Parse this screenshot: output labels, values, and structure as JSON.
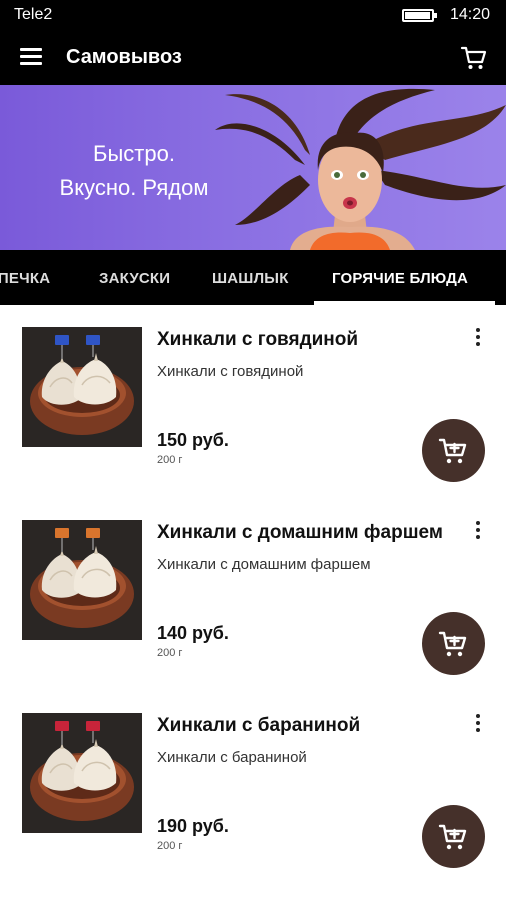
{
  "status_bar": {
    "carrier": "Tele2",
    "time": "14:20",
    "battery_level": 0.9
  },
  "app_bar": {
    "title": "Самовывоз"
  },
  "banner": {
    "line1": "Быстро.",
    "line2": "Вкусно. Рядом"
  },
  "tabs": [
    {
      "label": "ВЫПЕЧКА",
      "active": false
    },
    {
      "label": "ЗАКУСКИ",
      "active": false
    },
    {
      "label": "ШАШЛЫК",
      "active": false
    },
    {
      "label": "ГОРЯЧИЕ БЛЮДА",
      "active": true
    }
  ],
  "products": [
    {
      "name": "Хинкали с говядиной",
      "description": "Хинкали с говядиной",
      "price": "150 руб.",
      "weight": "200 г"
    },
    {
      "name": "Хинкали с домашним фаршем",
      "description": "Хинкали с домашним фаршем",
      "price": "140 руб.",
      "weight": "200 г"
    },
    {
      "name": "Хинкали с бараниной",
      "description": "Хинкали с бараниной",
      "price": "190 руб.",
      "weight": "200 г"
    }
  ],
  "colors": {
    "bar": "#000000",
    "banner": "#8a6fe2",
    "add_button": "#45302a",
    "tab_indicator": "#ffffff"
  }
}
